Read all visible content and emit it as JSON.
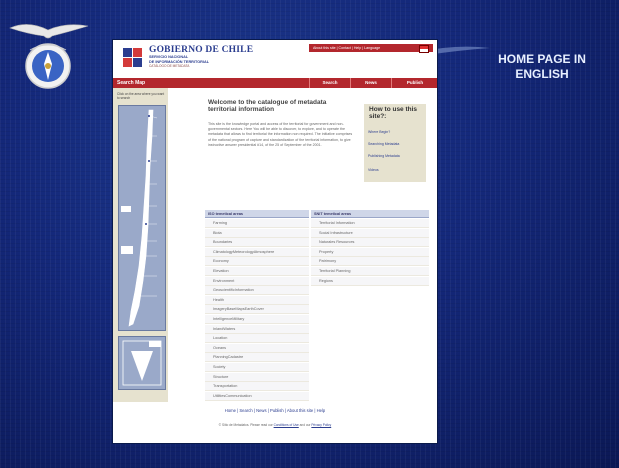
{
  "slide": {
    "title": "HOME PAGE IN ENGLISH"
  },
  "site": {
    "brand": {
      "name": "GOBIERNO DE CHILE",
      "line1": "SERVICIO NACIONAL",
      "line2": "DE INFORMACIÓN TERRITORIAL",
      "line3": "CATÁLOGO DE METADATA"
    },
    "toplinks": "About this site | Contact | Help | Language",
    "nav": {
      "search_map": "Search Map",
      "tabs": [
        "Search",
        "News",
        "Publish"
      ]
    },
    "map_note": "Click on the area where you want to search",
    "welcome": {
      "title": "Welcome to the catalogue of metadata territorial information",
      "body": "This site is the knowledge portal and access of the territorial for government and non-governmental sectors. Here You will be able to discover, to explore, and to operate the metadata that allows to find territorial the information non required. The initiative comprises of the national program of capture and standardization of the territorial information, to give instructive answer presidential #14, of the 25 of September of the 2001."
    },
    "howto": {
      "title": "How to use this site?:",
      "items": [
        "Where Begin?",
        "Searching Metadata",
        "Publishing Metadata",
        "Videos"
      ]
    },
    "iso": {
      "header": "ISO temetical areas",
      "items": [
        "Farming",
        "Biota",
        "Boundaries",
        "ClimatologyMeteorologyAtmosphere",
        "Economy",
        "Elevation",
        "Environment",
        "GeoscientificInformation",
        "Health",
        "ImageryBaseMapsEarthCover",
        "IntelligenceMilitary",
        "InlandWaters",
        "Location",
        "Oceans",
        "PlanningCadastre",
        "Society",
        "Structure",
        "Transportation",
        "UtilitiesCommunication"
      ]
    },
    "snit": {
      "header": "SNIT temetical areas",
      "items": [
        "Territorial Information",
        "Social Infrastructure",
        "Naturales Resources",
        "Property",
        "Patrimony",
        "Territorial Planning",
        "Regions"
      ]
    },
    "footer": {
      "links": "Home | Search | News | Publish | About this site | Help",
      "copyright": "© Sitio de Metadatos. Please read our",
      "terms": "Conditions of Use",
      "and": "and our",
      "privacy": "Privacy Policy"
    }
  }
}
